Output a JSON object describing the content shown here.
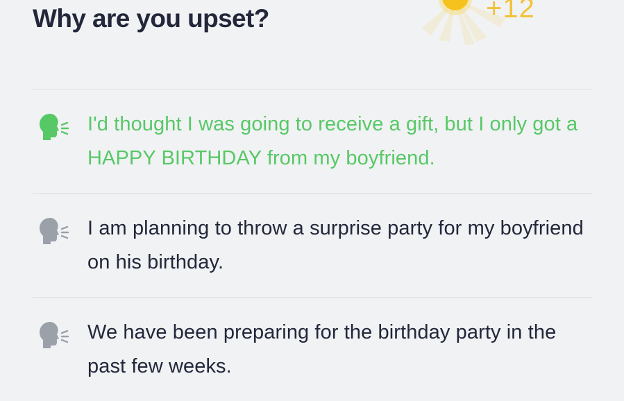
{
  "question": {
    "title": "Why are you upset?"
  },
  "reward": {
    "text": "+12",
    "color": "#f2c238"
  },
  "options": [
    {
      "text": "I'd thought I was going to receive a gift, but I only got a HAPPY BIRTHDAY from my boyfriend.",
      "selected": true,
      "icon": "speaking-head-icon"
    },
    {
      "text": "I am planning to throw a surprise party for my boyfriend on his birthday.",
      "selected": false,
      "icon": "speaking-head-icon"
    },
    {
      "text": "We have been preparing for the birthday party in the past few weeks.",
      "selected": false,
      "icon": "speaking-head-icon"
    }
  ],
  "colors": {
    "selected": "#57c866",
    "unselected_icon": "#9aa1a9",
    "text": "#22273a",
    "background": "#f1f2f4"
  }
}
